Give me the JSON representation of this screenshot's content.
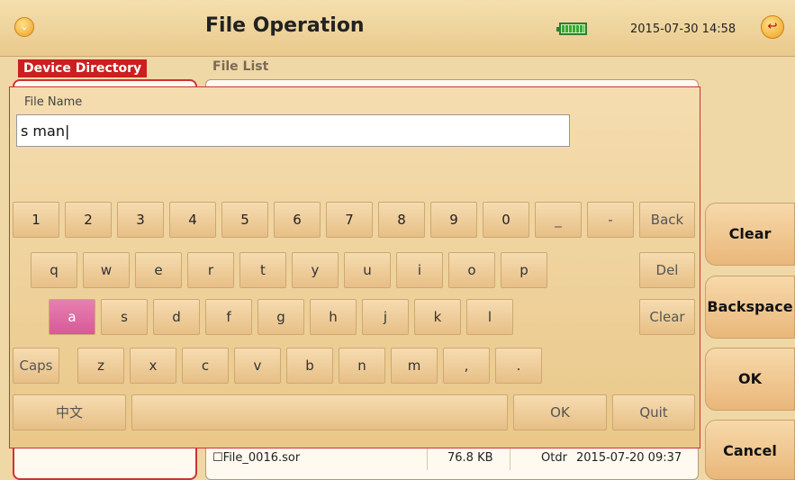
{
  "header": {
    "title": "File Operation",
    "datetime": "2015-07-30 14:58",
    "menu_icon": "chevron-down-circle-icon",
    "exit_icon": "exit-icon"
  },
  "tabs": {
    "device_directory": "Device Directory",
    "file_list": "File List"
  },
  "file_list": {
    "rows": [
      {
        "name": "File_0016.sor",
        "size": "76.8 KB",
        "type": "Otdr",
        "date": "2015-07-20 09:37"
      }
    ]
  },
  "side_buttons": {
    "clear": "Clear",
    "backspace": "Backspace",
    "ok": "OK",
    "cancel": "Cancel"
  },
  "dialog": {
    "field_label": "File Name",
    "file_name_value": "s man|"
  },
  "keyboard": {
    "row1": [
      "1",
      "2",
      "3",
      "4",
      "5",
      "6",
      "7",
      "8",
      "9",
      "0",
      "_",
      "-",
      "Back"
    ],
    "row2": [
      "q",
      "w",
      "e",
      "r",
      "t",
      "y",
      "u",
      "i",
      "o",
      "p",
      "Del"
    ],
    "row3": [
      "a",
      "s",
      "d",
      "f",
      "g",
      "h",
      "j",
      "k",
      "l",
      "Clear"
    ],
    "row4": [
      "Caps",
      "z",
      "x",
      "c",
      "v",
      "b",
      "n",
      "m",
      ",",
      "."
    ],
    "row5": [
      "中文",
      "",
      "OK",
      "Quit"
    ],
    "active_key": "a"
  },
  "colors": {
    "accent_red": "#cc1f1f",
    "active_key": "#d65a99",
    "panel": "#e9c889"
  }
}
